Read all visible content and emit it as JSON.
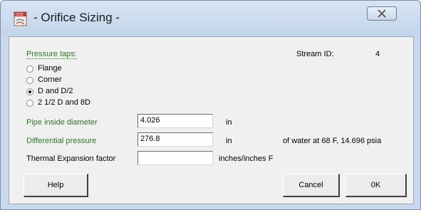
{
  "window": {
    "title": "- Orifice Sizing -"
  },
  "icons": {
    "app": "doc-app-icon",
    "close": "close-icon"
  },
  "pressure_taps": {
    "label": "Pressure taps:",
    "options": [
      {
        "label": "Flange",
        "selected": false
      },
      {
        "label": "Corner",
        "selected": false
      },
      {
        "label": "D and D/2",
        "selected": true
      },
      {
        "label": "2 1/2 D and 8D",
        "selected": false
      }
    ]
  },
  "stream": {
    "label": "Stream ID:",
    "value": "4"
  },
  "pipe_diameter": {
    "label": "Pipe inside diameter",
    "value": "4.026",
    "unit": "in"
  },
  "diff_pressure": {
    "label": "Differential pressure",
    "value": "276.8",
    "unit": "in",
    "note": "of  water at 68 F, 14.696 psia"
  },
  "thermal": {
    "label": "Thermal Expansion factor",
    "value": "",
    "unit": "inches/inches F"
  },
  "buttons": {
    "help": "Help",
    "cancel": "Cancel",
    "ok": "0K"
  },
  "colors": {
    "accent_label": "#2a7a1f",
    "titlebar": "#c9d9ec"
  }
}
